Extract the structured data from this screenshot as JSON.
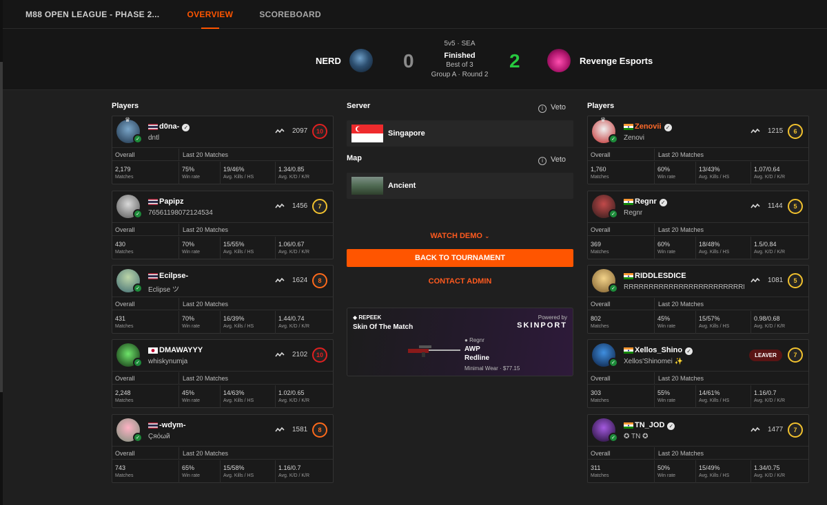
{
  "nav": {
    "league": "M88 OPEN LEAGUE - PHASE 2...",
    "tabs": [
      "OVERVIEW",
      "SCOREBOARD"
    ],
    "active_tab": "OVERVIEW"
  },
  "match": {
    "team1": {
      "name": "NERD",
      "score": "0"
    },
    "team2": {
      "name": "Revenge Esports",
      "score": "2"
    },
    "format": "5v5 · SEA",
    "status": "Finished",
    "best_of": "Best of 3",
    "group": "Group A · Round 2"
  },
  "labels": {
    "players": "Players",
    "overall": "Overall",
    "last20": "Last 20 Matches",
    "matches": "Matches",
    "win_rate": "Win rate",
    "kills_hs": "Avg. Kills / HS",
    "kd_kr": "Avg. K/D / K/R",
    "server": "Server",
    "map": "Map",
    "veto": "Veto",
    "leaver": "LEAVER"
  },
  "server": {
    "name": "Singapore"
  },
  "map": {
    "name": "Ancient"
  },
  "actions": {
    "watch_demo": "WATCH DEMO",
    "back": "BACK TO TOURNAMENT",
    "contact": "CONTACT ADMIN"
  },
  "sotm": {
    "brand": "REPEEK",
    "title": "Skin Of The Match",
    "powered": "Powered by",
    "sponsor": "SKINPORT",
    "player": "Regnr",
    "weapon": "AWP",
    "skin": "Redline",
    "wear_price": "Minimal Wear · $77.15"
  },
  "colors": {
    "accent": "#ff5500",
    "win": "#27c93f",
    "lose": "#8a8a8a"
  },
  "team1_players": [
    {
      "name": "d0na-",
      "nick": "dntl",
      "elo": "2097",
      "level": "10",
      "level_color": "#e02020",
      "flag": "th",
      "verified": true,
      "crown": true,
      "matches": "2,179",
      "winrate": "75%",
      "kills_hs": "19/46%",
      "kd_kr": "1.34/0.85"
    },
    {
      "name": "Papipz",
      "nick": "76561198072124534",
      "elo": "1456",
      "level": "7",
      "level_color": "#f2c22e",
      "flag": "th",
      "verified": false,
      "crown": false,
      "matches": "430",
      "winrate": "70%",
      "kills_hs": "15/55%",
      "kd_kr": "1.06/0.67"
    },
    {
      "name": "Ecilpse-",
      "nick": "Eclipse ツ",
      "elo": "1624",
      "level": "8",
      "level_color": "#ff6a1a",
      "flag": "th",
      "verified": false,
      "crown": false,
      "matches": "431",
      "winrate": "70%",
      "kills_hs": "16/39%",
      "kd_kr": "1.44/0.74"
    },
    {
      "name": "DMAWAYYY",
      "nick": "whiskynumja",
      "elo": "2102",
      "level": "10",
      "level_color": "#e02020",
      "flag": "jp",
      "verified": false,
      "crown": false,
      "matches": "2,248",
      "winrate": "45%",
      "kills_hs": "14/63%",
      "kd_kr": "1.02/0.65"
    },
    {
      "name": "-wdym-",
      "nick": "Çяόωй",
      "elo": "1581",
      "level": "8",
      "level_color": "#ff6a1a",
      "flag": "th",
      "verified": false,
      "crown": false,
      "matches": "743",
      "winrate": "65%",
      "kills_hs": "15/58%",
      "kd_kr": "1.16/0.7"
    }
  ],
  "team2_players": [
    {
      "name": "Zenovii",
      "nick": "Zenovi",
      "elo": "1215",
      "level": "6",
      "level_color": "#f2c22e",
      "flag": "in",
      "verified": true,
      "crown": true,
      "orange": true,
      "leaver": false,
      "matches": "1,760",
      "winrate": "60%",
      "kills_hs": "13/43%",
      "kd_kr": "1.07/0.64"
    },
    {
      "name": "Regnr",
      "nick": "Regnr",
      "elo": "1144",
      "level": "5",
      "level_color": "#f2c22e",
      "flag": "in",
      "verified": true,
      "crown": false,
      "orange": false,
      "leaver": false,
      "matches": "369",
      "winrate": "60%",
      "kills_hs": "18/48%",
      "kd_kr": "1.5/0.84"
    },
    {
      "name": "RIDDLESDICE",
      "nick": "RRRRRRRRRRRRRRRRRRRRRRRRRRR...",
      "elo": "1081",
      "level": "5",
      "level_color": "#f2c22e",
      "flag": "in",
      "verified": false,
      "crown": false,
      "orange": false,
      "leaver": false,
      "matches": "802",
      "winrate": "45%",
      "kills_hs": "15/57%",
      "kd_kr": "0.98/0.68"
    },
    {
      "name": "Xellos_Shino",
      "nick": "Xellos'Shinomei ✨",
      "elo": "",
      "level": "7",
      "level_color": "#f2c22e",
      "flag": "in",
      "verified": true,
      "crown": false,
      "orange": false,
      "leaver": true,
      "matches": "303",
      "winrate": "55%",
      "kills_hs": "14/61%",
      "kd_kr": "1.16/0.7"
    },
    {
      "name": "TN_JOD",
      "nick": "✪ TN ✪",
      "elo": "1477",
      "level": "7",
      "level_color": "#f2c22e",
      "flag": "in",
      "verified": true,
      "crown": false,
      "orange": false,
      "leaver": false,
      "matches": "311",
      "winrate": "50%",
      "kills_hs": "15/49%",
      "kd_kr": "1.34/0.75"
    }
  ]
}
